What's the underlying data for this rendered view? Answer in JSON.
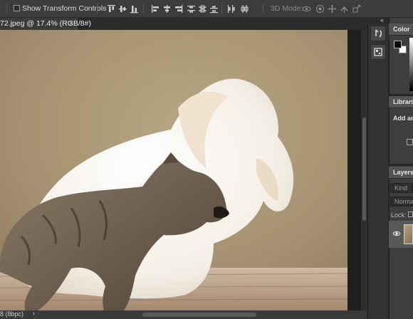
{
  "options_bar": {
    "show_transform_controls_label": "Show Transform Controls",
    "show_transform_controls_checked": false,
    "three_d_mode_label": "3D Mode:"
  },
  "document": {
    "tab_title": "72.jpeg @ 17.4% (RGB/8#)",
    "close_glyph": "×"
  },
  "status_bar": {
    "text": "8 (8bpc)",
    "arrow": "›"
  },
  "panels": {
    "collapse_glyph": "«",
    "color": {
      "title": "Color",
      "foreground": "#000000",
      "background": "#ffffff"
    },
    "libraries": {
      "title": "Libraries",
      "add_text": "Add an"
    },
    "layers": {
      "title": "Layers",
      "kind_placeholder": "Kind",
      "blend_mode": "Normal",
      "lock_label": "Lock:"
    }
  },
  "colors": {
    "app_bg": "#3c3c3c",
    "panel_header": "#535353",
    "canvas_backdrop": "#a8966f"
  },
  "icons": [
    "align-top-edges-icon",
    "align-vertical-centers-icon",
    "align-bottom-edges-icon",
    "align-left-edges-icon",
    "align-horizontal-centers-icon",
    "align-right-edges-icon",
    "distribute-top-icon",
    "distribute-vcenter-icon",
    "distribute-bottom-icon",
    "distribute-left-icon",
    "distribute-hcenter-icon",
    "distribute-right-icon",
    "3d-orbit-icon",
    "3d-roll-icon",
    "3d-pan-icon",
    "3d-slide-icon",
    "3d-scale-icon",
    "history-panel-icon",
    "properties-panel-icon",
    "eye-icon"
  ]
}
